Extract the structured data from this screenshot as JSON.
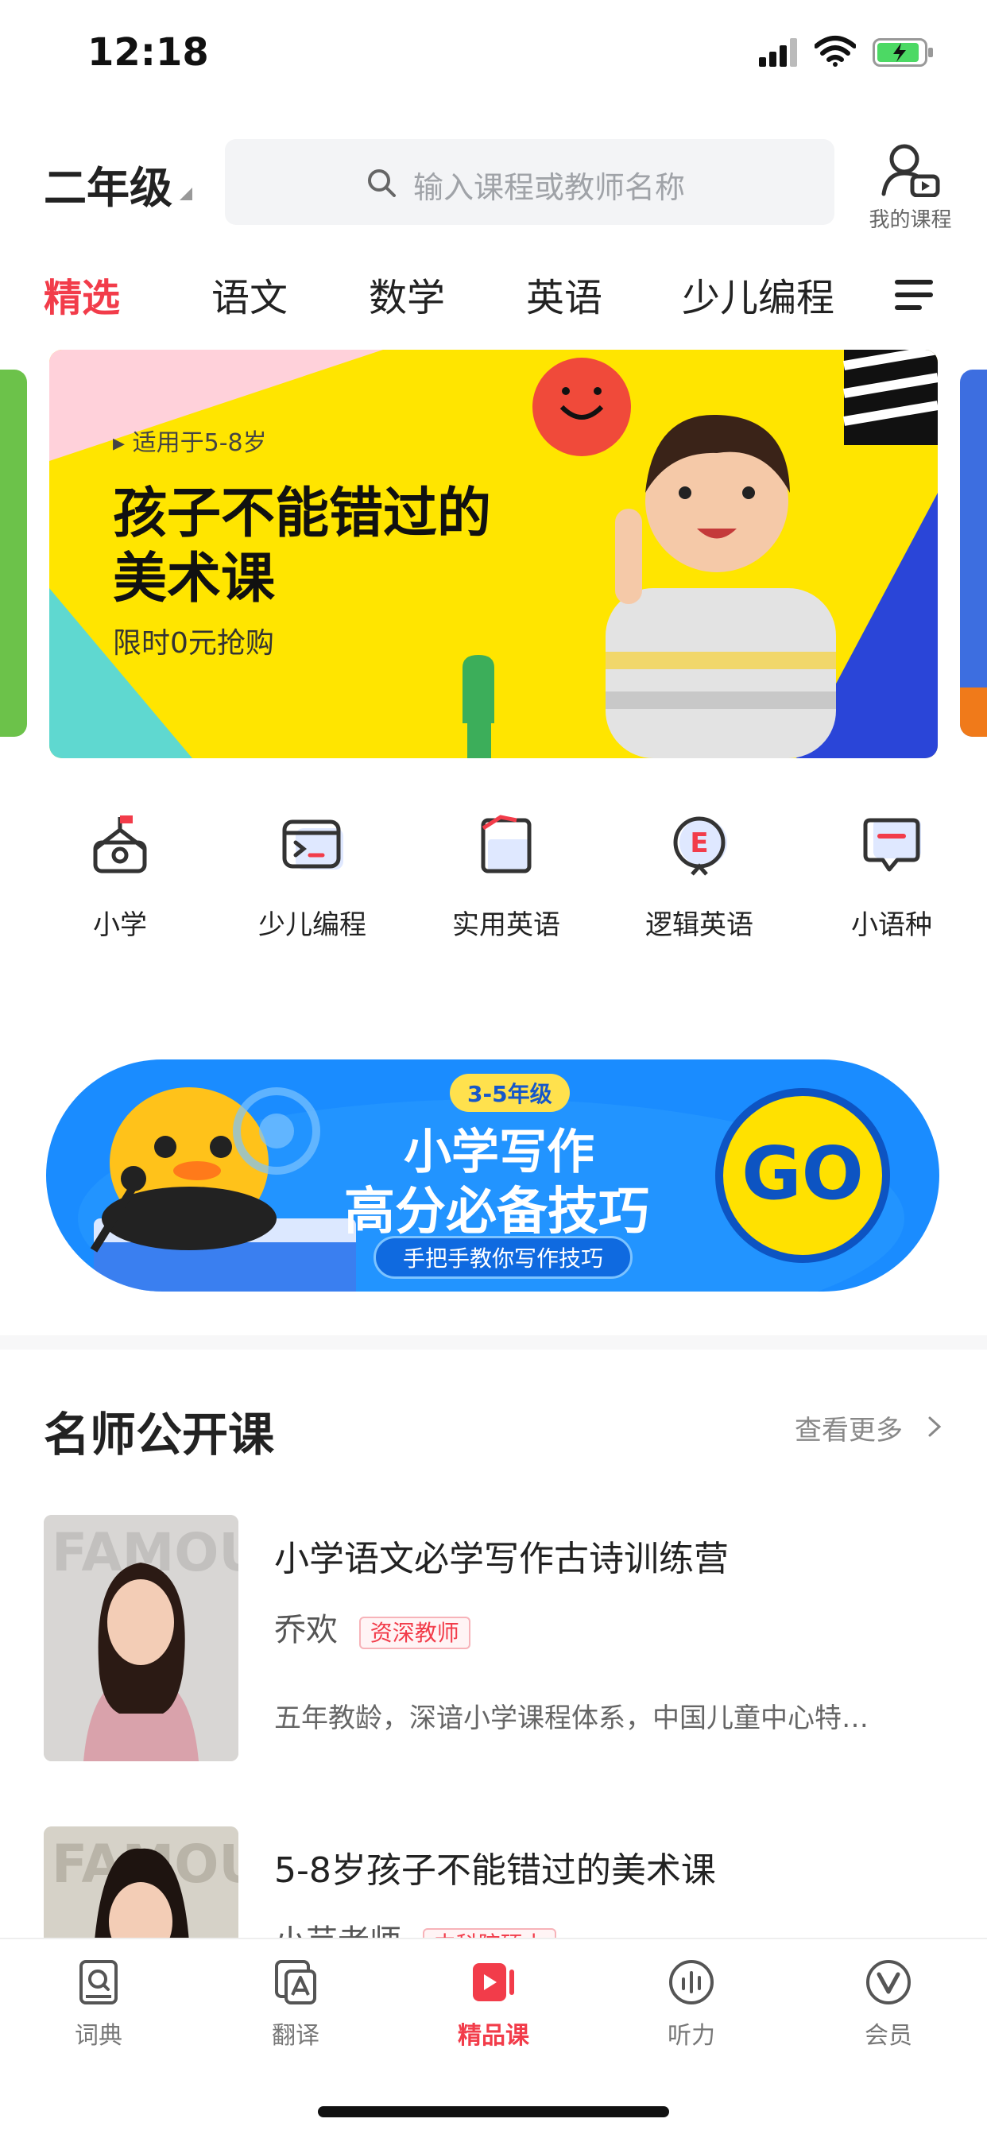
{
  "status_bar": {
    "time": "12:18"
  },
  "header": {
    "grade": "二年级",
    "search_placeholder": "输入课程或教师名称",
    "my_courses": "我的课程"
  },
  "tabs": [
    {
      "label": "精选",
      "active": true
    },
    {
      "label": "语文",
      "active": false
    },
    {
      "label": "数学",
      "active": false
    },
    {
      "label": "英语",
      "active": false
    },
    {
      "label": "少儿编程",
      "active": false
    }
  ],
  "banner": {
    "tag": "适用于5-8岁",
    "title_line1": "孩子不能错过的",
    "title_line2": "美术课",
    "subtitle": "限时0元抢购"
  },
  "categories": [
    {
      "label": "小学",
      "icon": "school-icon"
    },
    {
      "label": "少儿编程",
      "icon": "code-terminal-icon"
    },
    {
      "label": "实用英语",
      "icon": "book-icon"
    },
    {
      "label": "逻辑英语",
      "icon": "logic-e-icon"
    },
    {
      "label": "小语种",
      "icon": "chat-bubble-icon"
    }
  ],
  "promo": {
    "grade": "3-5年级",
    "title_line1": "小学写作",
    "title_line2": "高分必备技巧",
    "pill": "手把手教你写作技巧",
    "go": "GO"
  },
  "section": {
    "title": "名师公开课",
    "more": "查看更多"
  },
  "courses": [
    {
      "title": "小学语文必学写作古诗训练营",
      "teacher": "乔欢",
      "badge": "资深教师",
      "desc": "五年教龄，深谙小学课程体系，中国儿童中心特…"
    },
    {
      "title": "5-8岁孩子不能错过的美术课",
      "teacher": "小芸老师",
      "badge": "中科院硕士",
      "desc": ""
    }
  ],
  "bottom_nav": [
    {
      "label": "词典",
      "icon": "dictionary-icon",
      "active": false
    },
    {
      "label": "翻译",
      "icon": "translate-icon",
      "active": false
    },
    {
      "label": "精品课",
      "icon": "video-course-icon",
      "active": true
    },
    {
      "label": "听力",
      "icon": "listening-icon",
      "active": false
    },
    {
      "label": "会员",
      "icon": "vip-icon",
      "active": false
    }
  ],
  "colors": {
    "accent": "#f23c4a",
    "banner_yellow": "#ffe500",
    "promo_blue": "#1a8cff"
  }
}
